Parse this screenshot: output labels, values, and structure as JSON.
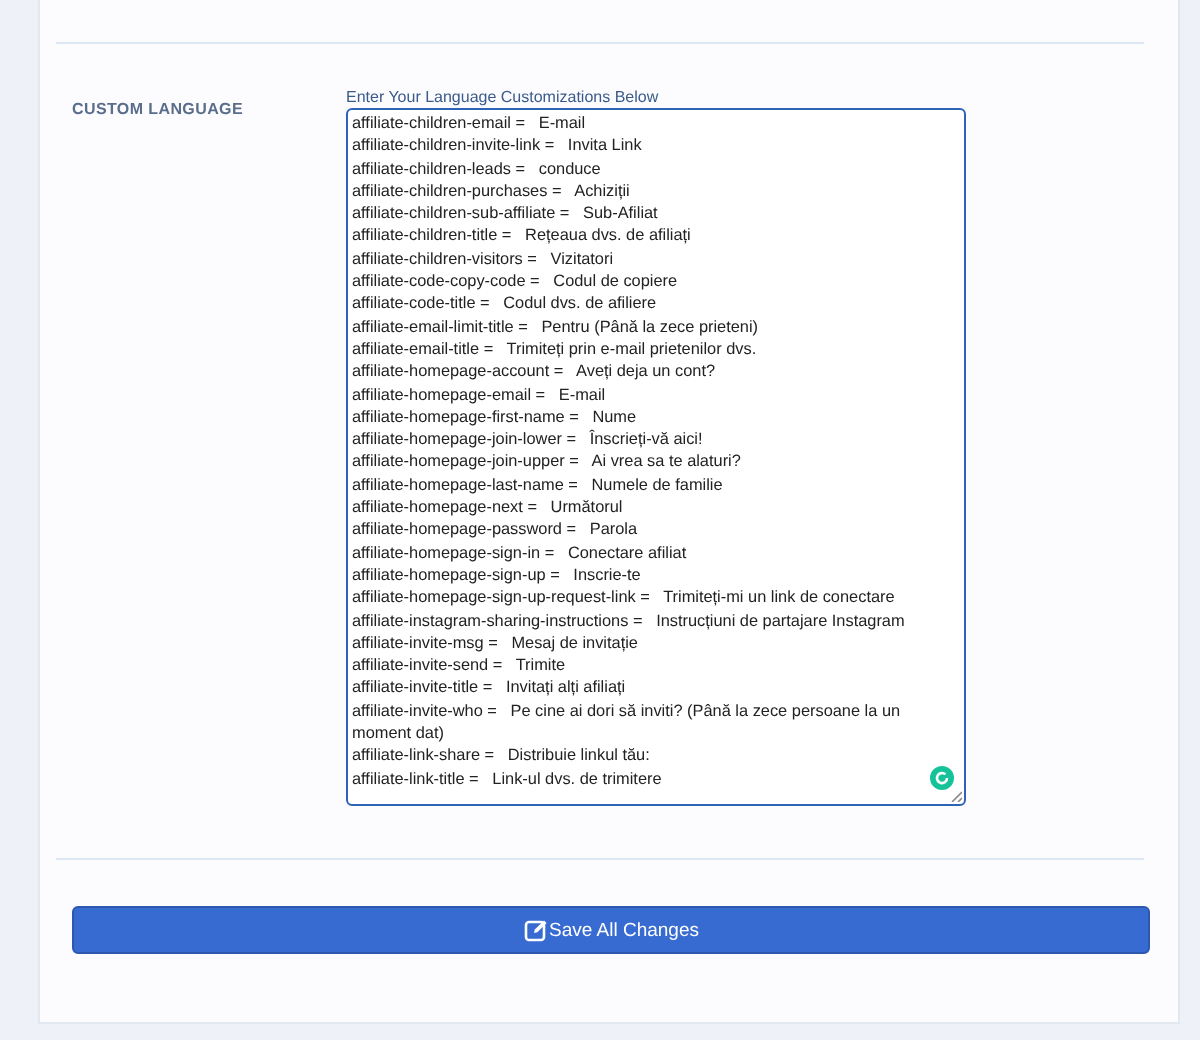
{
  "section": {
    "label": "CUSTOM LANGUAGE",
    "field_label": "Enter Your Language Customizations Below",
    "lines": [
      "affiliate-children-email =   E-mail",
      "affiliate-children-invite-link =   Invita Link",
      "affiliate-children-leads =   conduce",
      "affiliate-children-purchases =   Achiziții",
      "affiliate-children-sub-affiliate =   Sub-Afiliat",
      "affiliate-children-title =   Rețeaua dvs. de afiliați",
      "affiliate-children-visitors =   Vizitatori",
      "affiliate-code-copy-code =   Codul de copiere",
      "affiliate-code-title =   Codul dvs. de afiliere",
      "affiliate-email-limit-title =   Pentru (Până la zece prieteni)",
      "affiliate-email-title =   Trimiteți prin e-mail prietenilor dvs.",
      "affiliate-homepage-account =   Aveți deja un cont?",
      "affiliate-homepage-email =   E-mail",
      "affiliate-homepage-first-name =   Nume",
      "affiliate-homepage-join-lower =   Înscrieți-vă aici!",
      "affiliate-homepage-join-upper =   Ai vrea sa te alaturi?",
      "affiliate-homepage-last-name =   Numele de familie",
      "affiliate-homepage-next =   Următorul",
      "affiliate-homepage-password =   Parola",
      "affiliate-homepage-sign-in =   Conectare afiliat",
      "affiliate-homepage-sign-up =   Inscrie-te",
      "affiliate-homepage-sign-up-request-link =   Trimiteți-mi un link de conectare",
      "affiliate-instagram-sharing-instructions =   Instrucțiuni de partajare Instagram",
      "affiliate-invite-msg =   Mesaj de invitație",
      "affiliate-invite-send =   Trimite",
      "affiliate-invite-title =   Invitați alți afiliați",
      "affiliate-invite-who =   Pe cine ai dori să inviti? (Până la zece persoane la un moment dat)",
      "affiliate-link-share =   Distribuie linkul tău:",
      "affiliate-link-title =   Link-ul dvs. de trimitere"
    ]
  },
  "save_button": "Save All Changes"
}
